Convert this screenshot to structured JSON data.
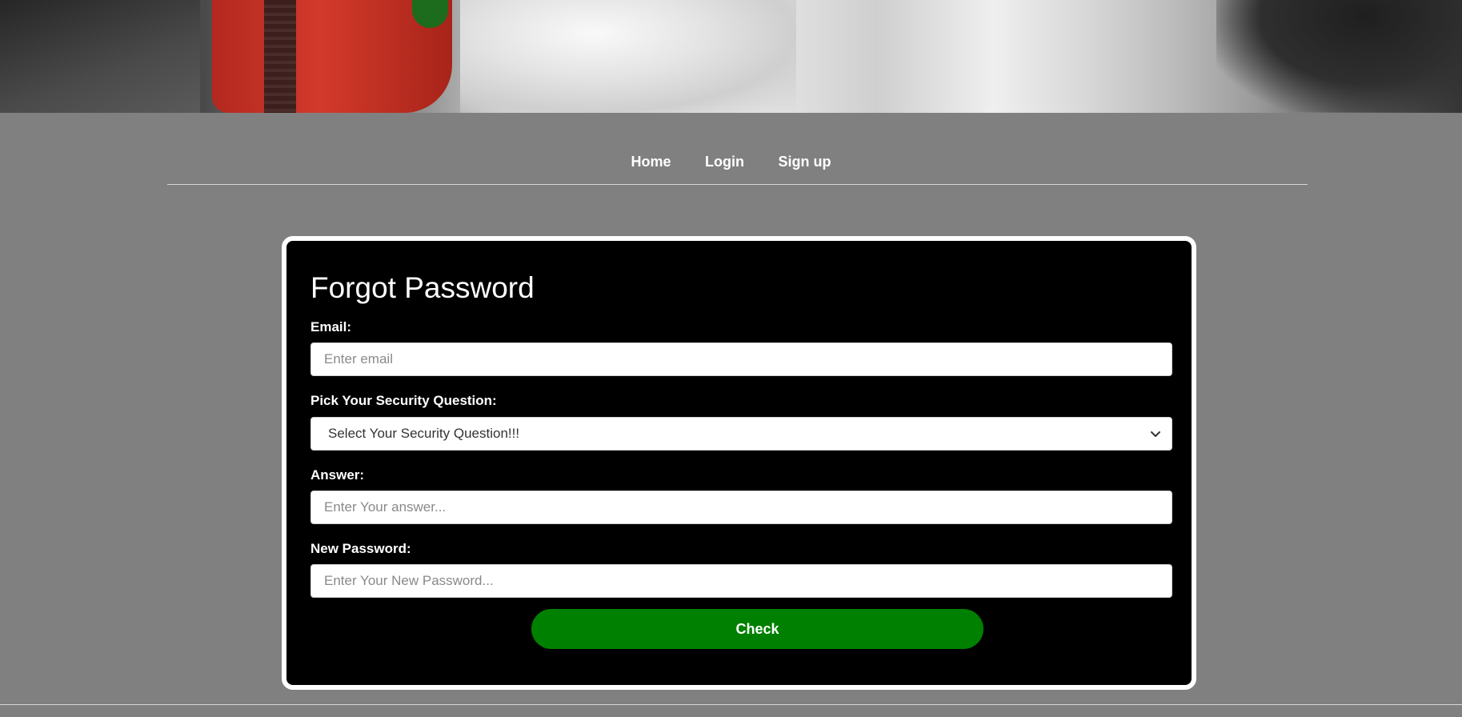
{
  "banner": {
    "image": "hero-banner-photo"
  },
  "nav": {
    "items": [
      {
        "label": "Home"
      },
      {
        "label": "Login"
      },
      {
        "label": "Sign up"
      }
    ]
  },
  "form": {
    "title": "Forgot Password",
    "email": {
      "label": "Email:",
      "placeholder": "Enter email",
      "value": ""
    },
    "security": {
      "label": "Pick Your Security Question:",
      "selected": "Select Your Security Question!!!"
    },
    "answer": {
      "label": "Answer:",
      "placeholder": "Enter Your answer...",
      "value": ""
    },
    "new_password": {
      "label": "New Password:",
      "placeholder": "Enter Your New Password...",
      "value": ""
    },
    "submit_label": "Check"
  },
  "colors": {
    "page_bg": "#808080",
    "card_bg": "#000000",
    "button_bg": "#008000",
    "text": "#ffffff"
  }
}
